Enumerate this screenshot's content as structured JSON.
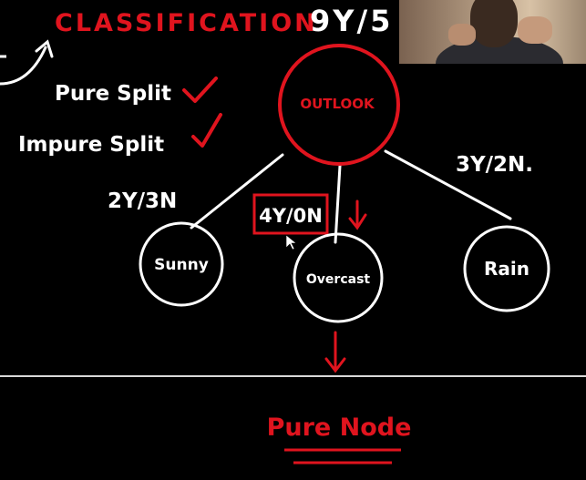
{
  "header": {
    "title": "CLASSIFICATION",
    "ratio": "9Y/5"
  },
  "notes": {
    "pure_split": "Pure Split",
    "impure_split": "Impure Split"
  },
  "tree": {
    "root": "OUTLOOK",
    "children": [
      {
        "label": "Sunny",
        "count": "2Y/3N"
      },
      {
        "label": "Overcast",
        "count": "4Y/0N"
      },
      {
        "label": "Rain",
        "count": "3Y/2N."
      }
    ],
    "pure_node": "Pure Node"
  },
  "colors": {
    "background": "#000000",
    "ink_white": "#ffffff",
    "ink_red": "#e0141e"
  },
  "icons": {
    "check": "check-icon",
    "arrow": "arrow-icon",
    "cursor": "mouse-cursor-icon"
  }
}
